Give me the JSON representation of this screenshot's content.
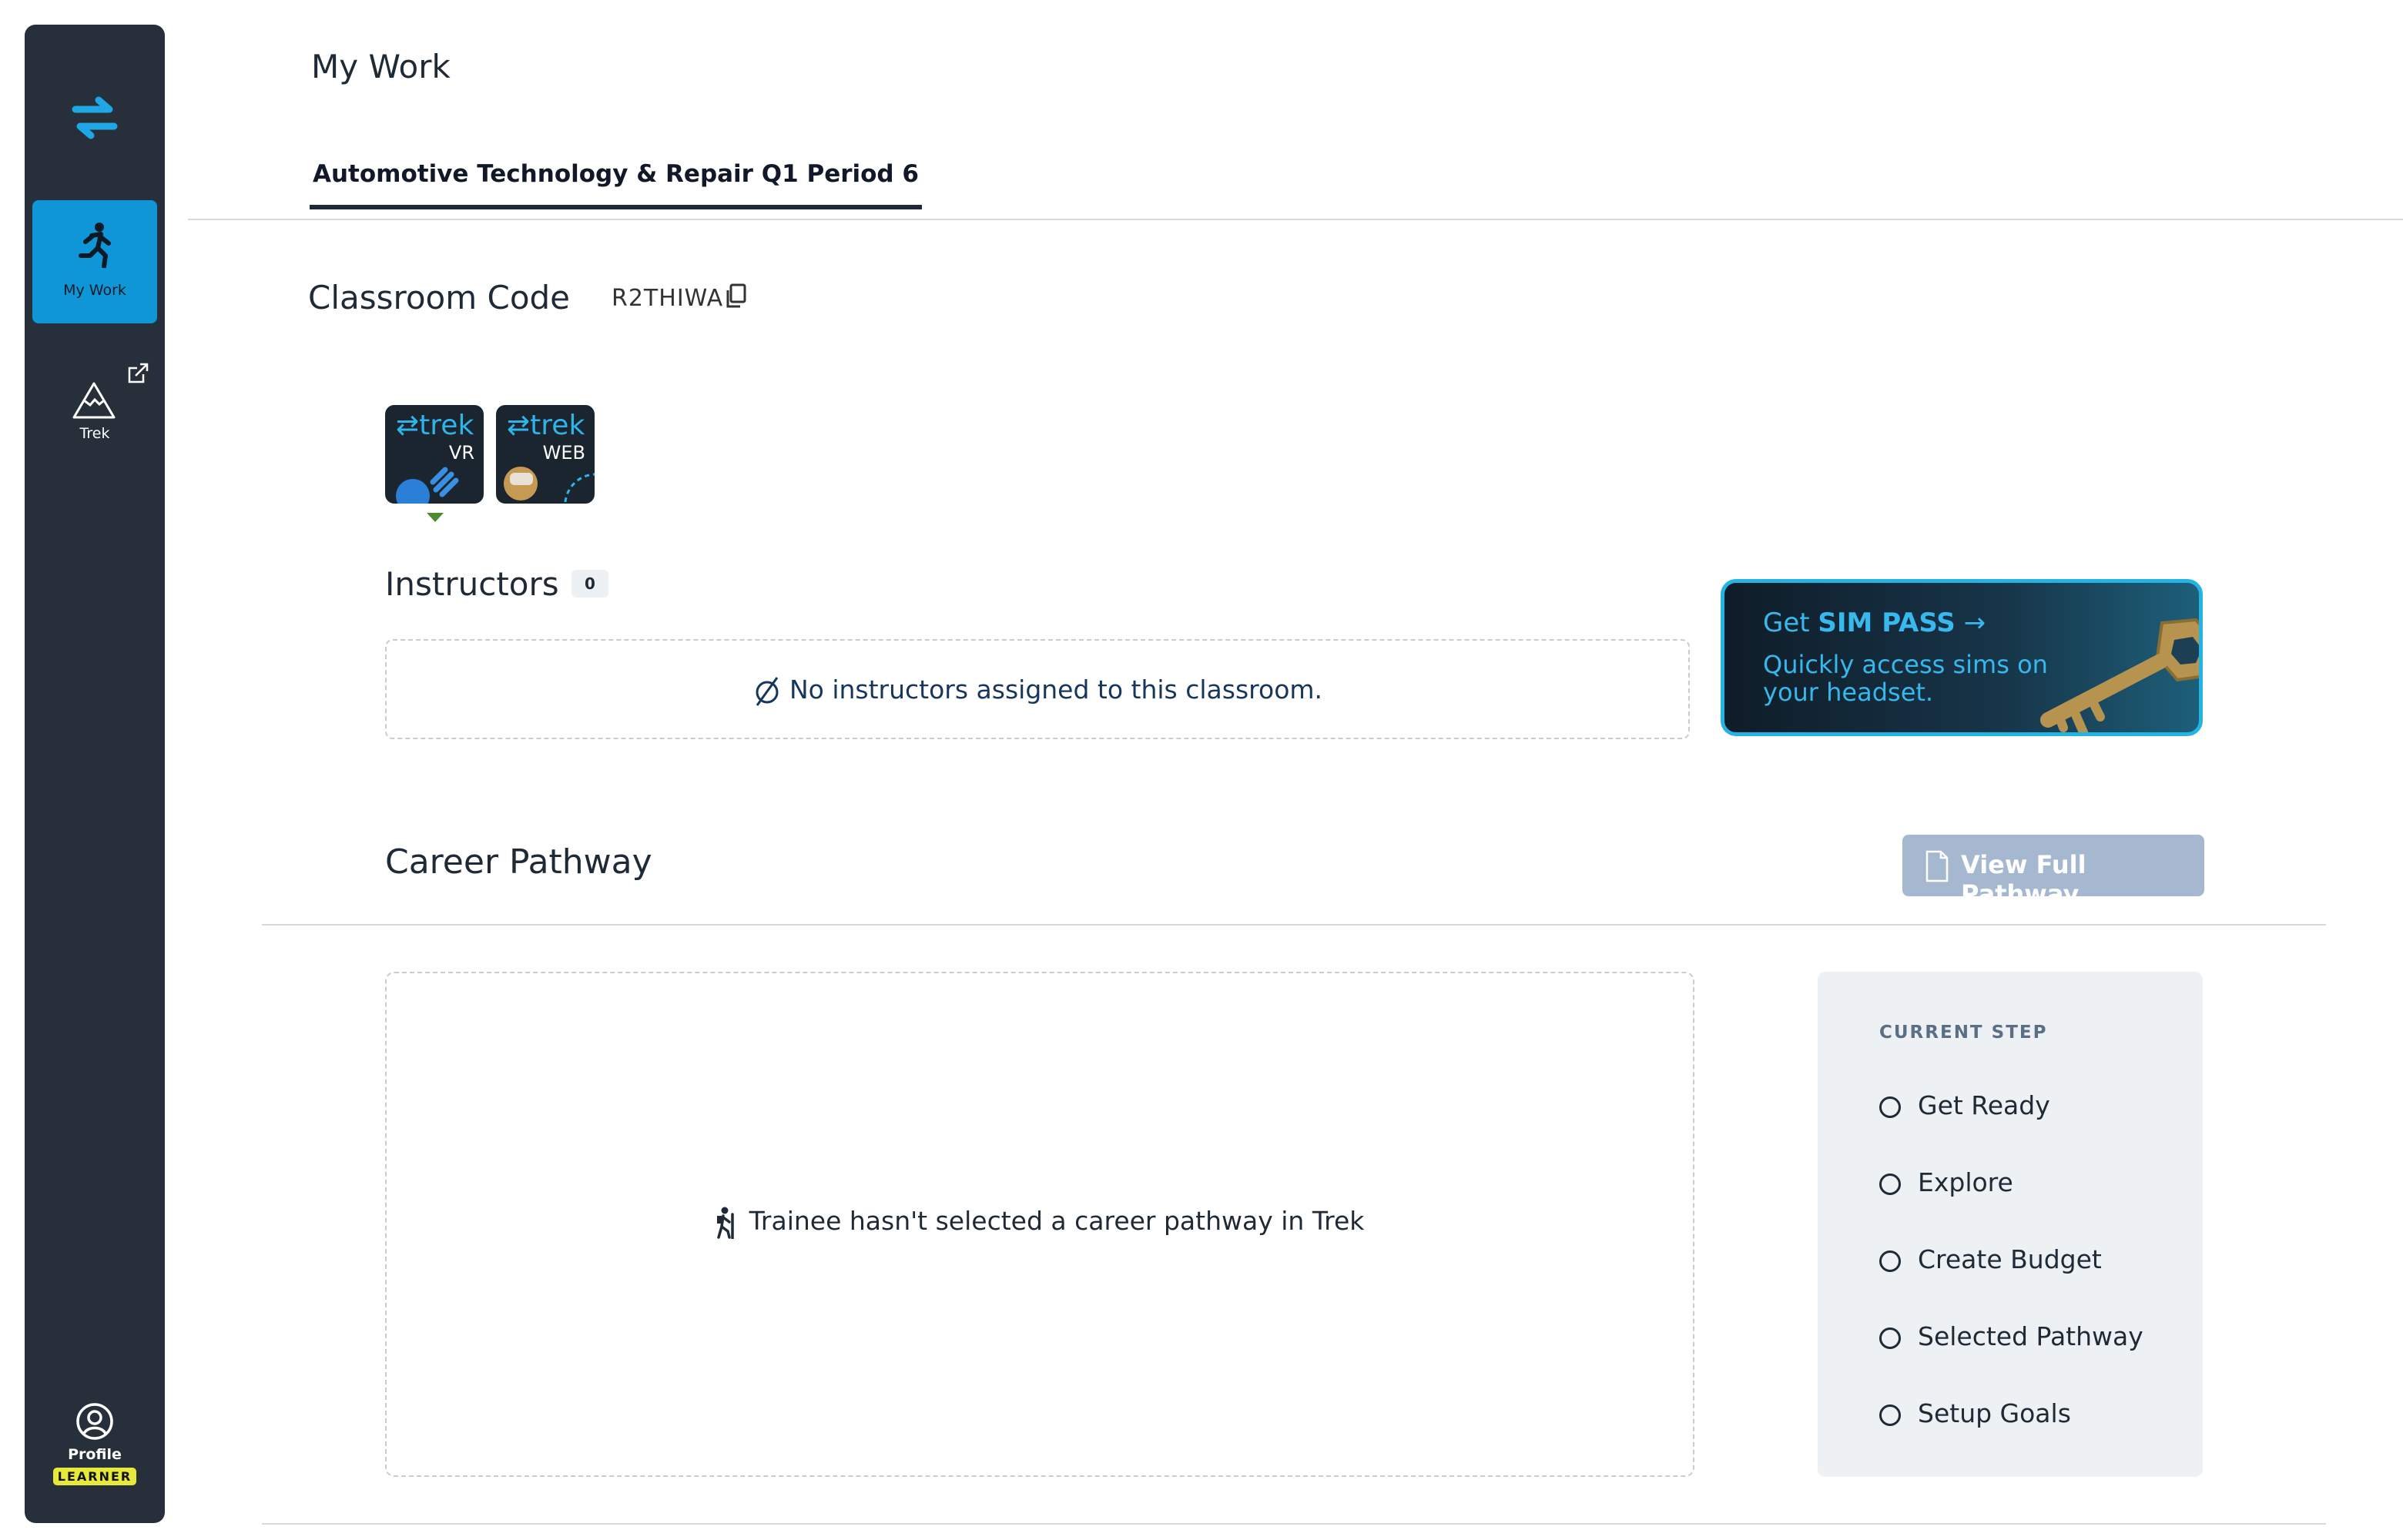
{
  "sidebar": {
    "logo_icon": "arrows-swap-icon",
    "items": [
      {
        "label": "My Work",
        "icon": "running-person-icon",
        "active": true
      },
      {
        "label": "Trek",
        "icon": "mountain-icon",
        "external": true
      }
    ],
    "profile": {
      "label": "Profile",
      "role": "LEARNER"
    }
  },
  "header": {
    "title": "My Work",
    "tabs": [
      {
        "label": "Automotive Technology & Repair Q1 Period 6",
        "active": true
      }
    ]
  },
  "classroom": {
    "code_label": "Classroom Code",
    "code": "R2THIWA"
  },
  "apps": [
    {
      "brand": "⇄trek",
      "kind": "VR",
      "selected": true
    },
    {
      "brand": "⇄trek",
      "kind": "WEB",
      "selected": false
    }
  ],
  "instructors": {
    "title": "Instructors",
    "count": "0",
    "empty_message": "No instructors assigned to this classroom."
  },
  "sim_pass": {
    "line1_prefix": "Get ",
    "line1_bold": "SIM PASS",
    "arrow": "→",
    "line2": "Quickly access sims on your headset."
  },
  "career": {
    "title": "Career Pathway",
    "view_button": "View Full Pathway",
    "empty_message": "Trainee hasn't selected a career pathway in Trek",
    "current_step_label": "CURRENT STEP",
    "steps": [
      "Get Ready",
      "Explore",
      "Create Budget",
      "Selected Pathway",
      "Setup Goals"
    ]
  },
  "colors": {
    "sidebar_bg": "#262f3a",
    "accent": "#0f96d6",
    "button_disabled": "#a5b8d0",
    "text_dark": "#1f2a37"
  }
}
